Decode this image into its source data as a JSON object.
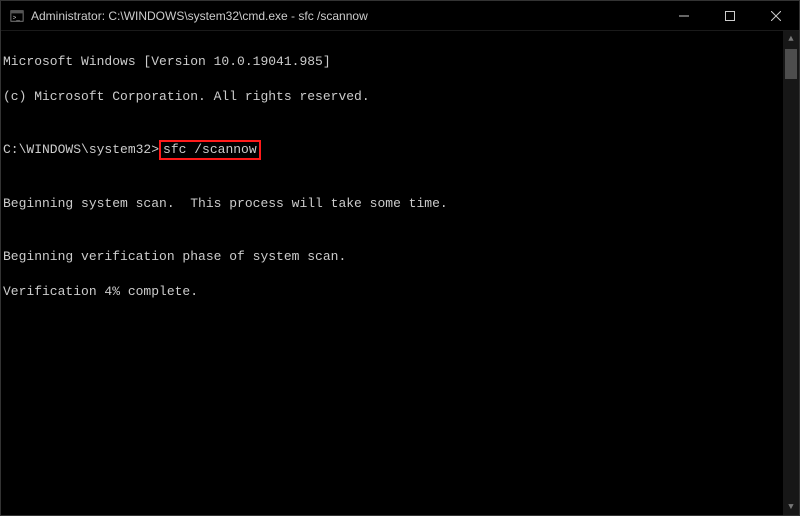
{
  "titlebar": {
    "title": "Administrator: C:\\WINDOWS\\system32\\cmd.exe - sfc  /scannow"
  },
  "terminal": {
    "line1": "Microsoft Windows [Version 10.0.19041.985]",
    "line2": "(c) Microsoft Corporation. All rights reserved.",
    "blank1": "",
    "prompt": "C:\\WINDOWS\\system32>",
    "command": "sfc /scannow",
    "blank2": "",
    "line3": "Beginning system scan.  This process will take some time.",
    "blank3": "",
    "line4": "Beginning verification phase of system scan.",
    "line5": "Verification 4% complete."
  },
  "controls": {
    "minimize": "—",
    "maximize": "☐",
    "close": "✕"
  }
}
